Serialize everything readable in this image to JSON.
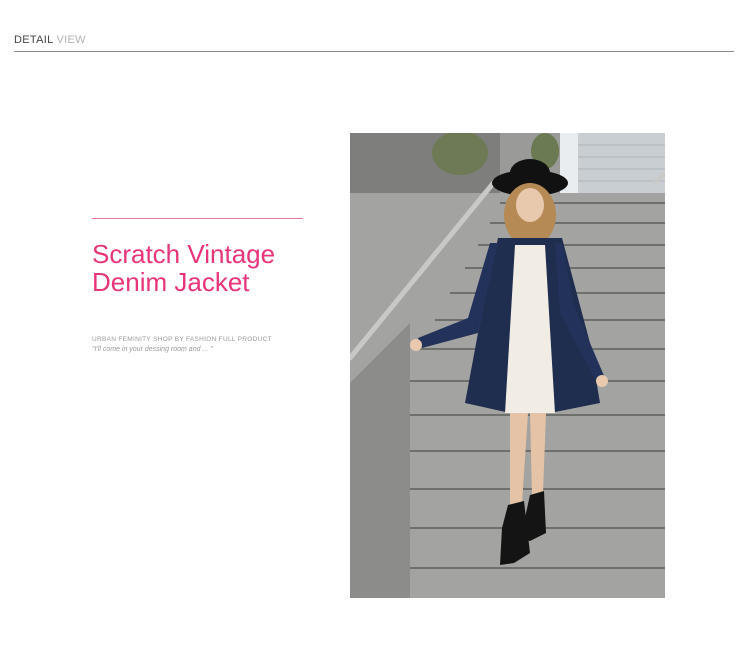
{
  "header": {
    "title_primary": "DETAIL",
    "title_secondary": "VIEW"
  },
  "product": {
    "title_line1": "Scratch Vintage",
    "title_line2": "Denim Jacket",
    "tagline": "URBAN FEMINITY SHOP BY  FASHION FULL PRODUCT",
    "quote": "\"I'll come in your dessing room and ... \""
  },
  "colors": {
    "accent_pink": "#e8347a",
    "accent_line": "#e8779b",
    "denim": "#1f2d4f"
  },
  "photo": {
    "icon": "product-photo"
  }
}
